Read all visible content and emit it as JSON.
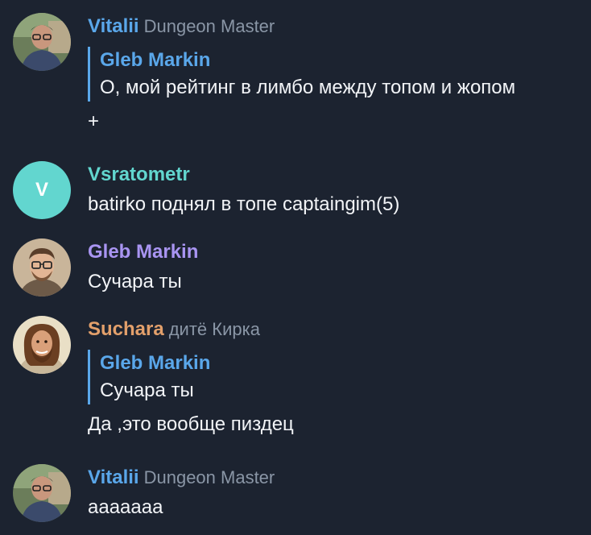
{
  "colors": {
    "background": "#1c2330",
    "vitalii": "#5aa7ea",
    "vsratometr": "#62d6cf",
    "gleb": "#a995f2",
    "suchara": "#e3a06b",
    "reply_accent": "#5aa7ea",
    "role": "#8a96a6"
  },
  "messages": [
    {
      "name": "Vitalii",
      "role": "Dungeon Master",
      "avatar": "photo-avatar",
      "reply": {
        "name": "Gleb Markin",
        "text": "О, мой рейтинг в лимбо между топом и жопом"
      },
      "text": "+"
    },
    {
      "name": "Vsratometr",
      "avatar_letter": "V",
      "text": "batirko поднял в топе  captaingim(5)"
    },
    {
      "name": "Gleb Markin",
      "avatar": "photo-avatar",
      "text": "Сучара ты"
    },
    {
      "name": "Suchara",
      "role": "дитё Кирка",
      "avatar": "photo-avatar",
      "reply": {
        "name": "Gleb Markin",
        "text": "Сучара ты"
      },
      "text": "Да ,это вообще пиздец"
    },
    {
      "name": "Vitalii",
      "role": "Dungeon Master",
      "avatar": "photo-avatar",
      "text": "ааааааа"
    }
  ]
}
